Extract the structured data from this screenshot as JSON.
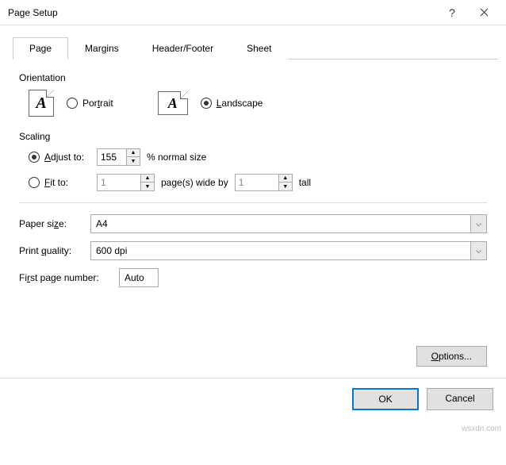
{
  "title": "Page Setup",
  "tabs": {
    "page": "Page",
    "margins": "Margins",
    "headerfooter": "Header/Footer",
    "sheet": "Sheet"
  },
  "orientation": {
    "label": "Orientation",
    "portrait": "Portrait",
    "landscape": "Landscape",
    "selected": "landscape"
  },
  "scaling": {
    "label": "Scaling",
    "adjust_label": "Adjust to:",
    "adjust_value": "155",
    "adjust_suffix": "% normal size",
    "fit_label": "Fit to:",
    "fit_wide": "1",
    "fit_mid": "page(s) wide by",
    "fit_tall": "1",
    "fit_suffix": "tall",
    "selected": "adjust"
  },
  "paper": {
    "label": "Paper size:",
    "value": "A4"
  },
  "quality": {
    "label": "Print quality:",
    "value": "600 dpi"
  },
  "firstpage": {
    "label": "First page number:",
    "value": "Auto"
  },
  "buttons": {
    "options": "Options...",
    "ok": "OK",
    "cancel": "Cancel"
  },
  "watermark": "wsxdn.com"
}
